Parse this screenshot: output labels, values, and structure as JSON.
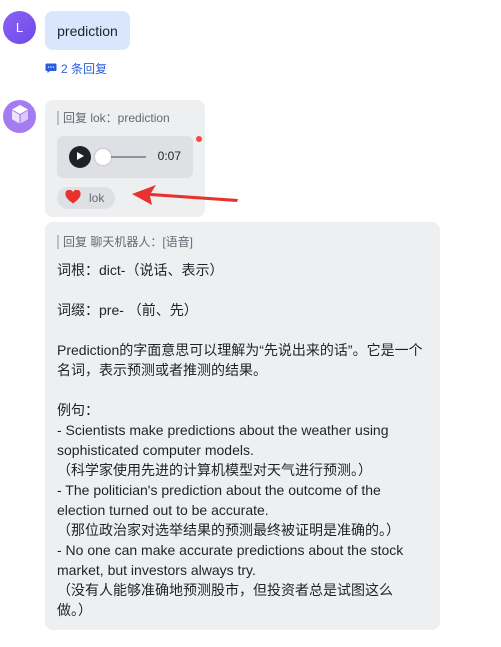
{
  "user_message": {
    "avatar_letter": "L",
    "text": "prediction",
    "reply_count_label": "2 条回复"
  },
  "voice_reply": {
    "quote": "回复 lok：prediction",
    "duration": "0:07",
    "reaction_emoji": "❤️",
    "reaction_user": "lok"
  },
  "text_reply": {
    "quote": "回复 聊天机器人：[语音]",
    "lines": [
      "词根：dict-（说话、表示）",
      "",
      "词缀：pre- （前、先）",
      "",
      "Prediction的字面意思可以理解为“先说出来的话”。它是一个",
      "名词，表示预测或者推测的结果。",
      "",
      "例句：",
      "- Scientists make predictions about the weather using",
      "sophisticated computer models.",
      "（科学家使用先进的计算机模型对天气进行预测。）",
      "- The politician's prediction about the outcome of the",
      "election turned out to be accurate.",
      "（那位政治家对选举结果的预测最终被证明是准确的。）",
      "- No one can make accurate predictions about the stock",
      "market, but investors always try.",
      "（没有人能够准确地预测股市，但投资者总是试图这么",
      "做。）"
    ]
  },
  "colors": {
    "bubble_user": "#d9e6fd",
    "bubble_bot": "#eeeff1",
    "link": "#2b5fd9",
    "annotation_arrow": "#e8322e"
  }
}
